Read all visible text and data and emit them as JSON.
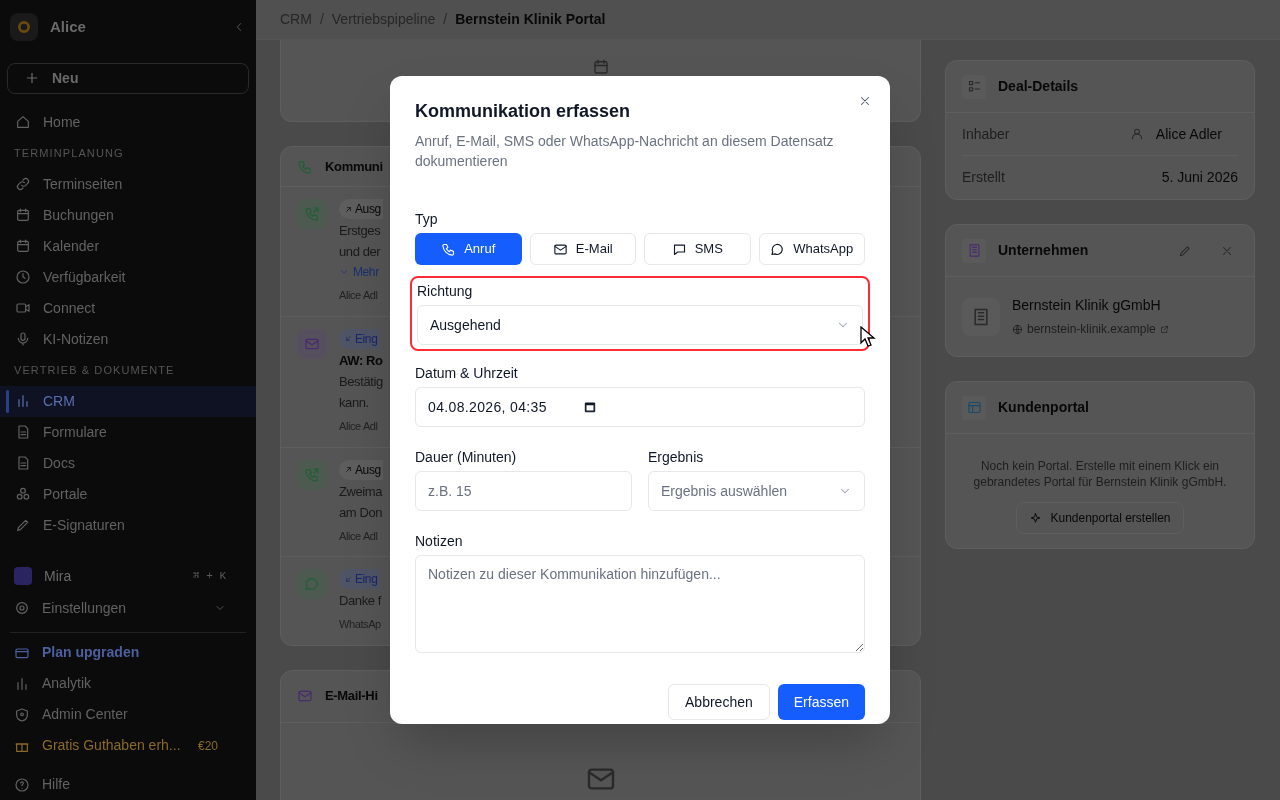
{
  "sidebar": {
    "workspace": "Alice",
    "new_button": "Neu",
    "nav": [
      {
        "kind": "item",
        "label": "Home",
        "selected": false
      },
      {
        "kind": "section",
        "label": "TERMINPLANUNG"
      },
      {
        "kind": "item",
        "label": "Terminseiten",
        "selected": false
      },
      {
        "kind": "item",
        "label": "Buchungen",
        "selected": false
      },
      {
        "kind": "item",
        "label": "Kalender",
        "selected": false
      },
      {
        "kind": "item",
        "label": "Verfügbarkeit",
        "selected": false
      },
      {
        "kind": "item",
        "label": "Connect",
        "selected": false
      },
      {
        "kind": "item",
        "label": "KI-Notizen",
        "selected": false
      },
      {
        "kind": "section",
        "label": "VERTRIEB & DOKUMENTE"
      },
      {
        "kind": "item",
        "label": "CRM",
        "selected": true
      },
      {
        "kind": "item",
        "label": "Formulare",
        "selected": false
      },
      {
        "kind": "item",
        "label": "Docs",
        "selected": false
      },
      {
        "kind": "item",
        "label": "Portale",
        "selected": false
      },
      {
        "kind": "item",
        "label": "E-Signaturen",
        "selected": false
      }
    ],
    "assistant": {
      "label": "Mira",
      "shortcut": "⌘ + K"
    },
    "settings": {
      "label": "Einstellungen",
      "expanded": false
    },
    "footer": [
      {
        "kind": "upgrade",
        "label": "Plan upgraden"
      },
      {
        "kind": "item",
        "label": "Analytik"
      },
      {
        "kind": "item",
        "label": "Admin Center"
      },
      {
        "kind": "promo",
        "label": "Gratis Guthaben erh...",
        "badge": "€20"
      },
      {
        "kind": "help",
        "label": "Hilfe"
      }
    ]
  },
  "breadcrumb": {
    "separator": "/",
    "items": [
      {
        "label": "CRM",
        "current": false
      },
      {
        "label": "Vertriebspipeline",
        "current": false
      },
      {
        "label": "Bernstein Klinik Portal",
        "current": true
      }
    ]
  },
  "communications": {
    "title": "Kommuni",
    "entries": [
      {
        "kind": "call",
        "badge": {
          "kind": "outgoing",
          "label": "Ausg"
        },
        "lines": [
          "Erstges",
          "und der"
        ],
        "more": "Mehr",
        "meta": "Alice Adl"
      },
      {
        "kind": "email",
        "badge": {
          "kind": "incoming",
          "label": "Eing"
        },
        "title": "AW: Ro",
        "lines": [
          "Bestätig",
          "kann."
        ],
        "meta": "Alice Adl"
      },
      {
        "kind": "call",
        "badge": {
          "kind": "outgoing",
          "label": "Ausg"
        },
        "lines": [
          "Zweima",
          "am Don"
        ],
        "meta": "Alice Adl"
      },
      {
        "kind": "whatsapp",
        "badge": {
          "kind": "incoming",
          "label": "Eing"
        },
        "lines": [
          "Danke f"
        ],
        "meta": "WhatsAp"
      }
    ]
  },
  "email_history": {
    "title": "E-Mail-Hi"
  },
  "deal_details": {
    "title": "Deal-Details",
    "rows": [
      {
        "label": "Inhaber",
        "value": "Alice Adler",
        "kind": "person"
      },
      {
        "label": "Erstellt",
        "value": "5. Juni 2026",
        "kind": "text"
      }
    ]
  },
  "company": {
    "title": "Unternehmen",
    "name": "Bernstein Klinik gGmbH",
    "website": "bernstein-klinik.example"
  },
  "customer_portal": {
    "title": "Kundenportal",
    "text": "Noch kein Portal. Erstelle mit einem Klick ein gebrandetes Portal für Bernstein Klinik gGmbH.",
    "button": "Kundenportal erstellen"
  },
  "dialog": {
    "title": "Kommunikation erfassen",
    "subtitle": "Anruf, E-Mail, SMS oder WhatsApp-Nachricht an diesem Datensatz dokumentieren",
    "type_label": "Typ",
    "types": [
      {
        "kind": "call",
        "label": "Anruf",
        "selected": true
      },
      {
        "kind": "email",
        "label": "E-Mail",
        "selected": false
      },
      {
        "kind": "sms",
        "label": "SMS",
        "selected": false
      },
      {
        "kind": "whatsapp",
        "label": "WhatsApp",
        "selected": false
      }
    ],
    "direction": {
      "label": "Richtung",
      "value": "Ausgehend",
      "highlighted": true
    },
    "datetime": {
      "label": "Datum & Uhrzeit",
      "value": "04.08.2026, 04:35"
    },
    "duration": {
      "label": "Dauer (Minuten)",
      "placeholder": "z.B. 15"
    },
    "result": {
      "label": "Ergebnis",
      "placeholder": "Ergebnis auswählen"
    },
    "notes": {
      "label": "Notizen",
      "placeholder": "Notizen zu dieser Kommunikation hinzufügen..."
    },
    "cancel": "Abbrechen",
    "submit": "Erfassen"
  }
}
